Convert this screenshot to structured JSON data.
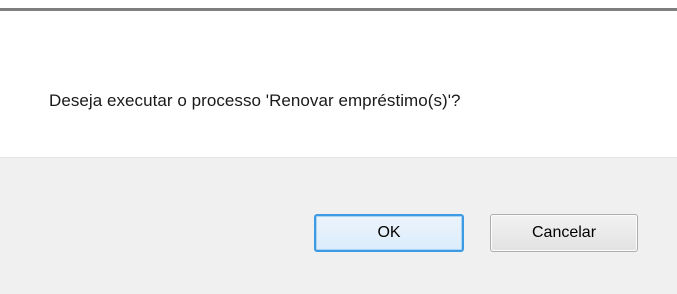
{
  "dialog": {
    "message": "Deseja executar o processo 'Renovar empréstimo(s)'?",
    "ok_label": "OK",
    "cancel_label": "Cancelar"
  },
  "colors": {
    "border_top": "#7f7f7f",
    "button_bar_background": "#f0f0f0",
    "focused_button_border": "#3c9be2",
    "button_border": "#adadad"
  }
}
